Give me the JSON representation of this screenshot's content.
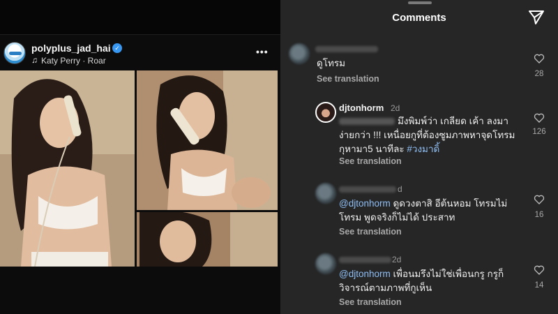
{
  "post": {
    "username": "polyplus_jad_hai",
    "music": "Katy Perry · Roar"
  },
  "comments_panel": {
    "title": "Comments",
    "comments": [
      {
        "username": "",
        "time": "",
        "text": "ดูโทรม",
        "mention": "",
        "see_translation": "See translation",
        "likes": "28"
      },
      {
        "username": "djtonhorm",
        "time": "2d",
        "text": "มึงพิมพ์ว่า เกลียด เค้า ลงมา ง่ายกว่า !!! เหนื่อยกูที่ต้องซูมภาพหาจุดโทรม กุหามา5 นาทีละ ",
        "hashtag": "#วงมาดิ้",
        "see_translation": "See translation",
        "likes": "126"
      },
      {
        "username": "",
        "time": "d",
        "mention": "@djtonhorm",
        "text": " ดูดวงตาสิ อีต้นหอม โทรมไม่โทรม พูดจริงก็ไม่ได้ ประสาท",
        "see_translation": "See translation",
        "likes": "16"
      },
      {
        "username": "",
        "time": "2d",
        "mention": "@djtonhorm",
        "text": " เพื่อนมรึงไม่ใช่เพื่อนกรู กรูก็วิจารณ์ตามภาพที่กูเห็น",
        "see_translation": "See translation",
        "likes": "14"
      }
    ]
  }
}
